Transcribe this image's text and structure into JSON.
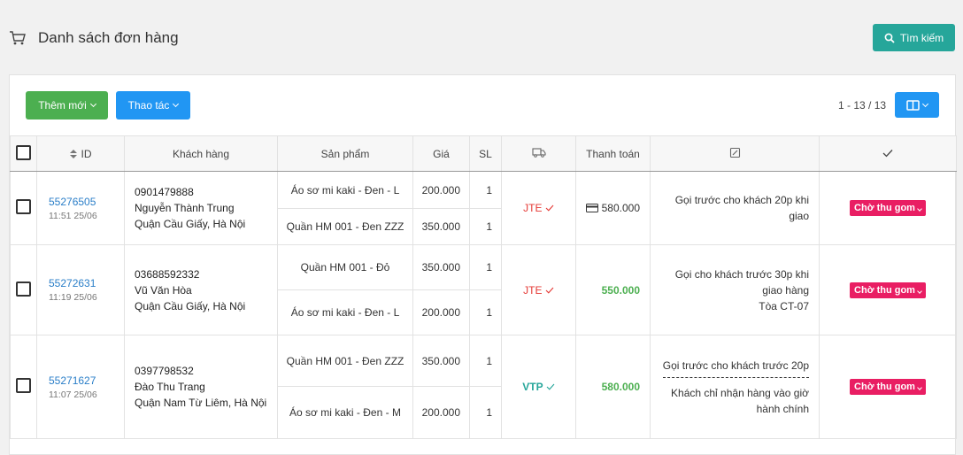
{
  "header": {
    "title": "Danh sách đơn hàng",
    "search_label": "Tìm kiếm"
  },
  "toolbar": {
    "add_label": "Thêm mới",
    "actions_label": "Thao tác",
    "pager": "1 - 13 / 13"
  },
  "columns": {
    "id": "ID",
    "customer": "Khách hàng",
    "product": "Sản phẩm",
    "price": "Giá",
    "qty": "SL",
    "payment": "Thanh toán"
  },
  "orders": [
    {
      "id": "55276505",
      "time": "11:51 25/06",
      "phone": "0901479888",
      "name": "Nguyễn Thành Trung",
      "address": "Quận Cầu Giấy, Hà Nội",
      "items": [
        {
          "product": "Áo sơ mi kaki - Đen - L",
          "price": "200.000",
          "qty": "1"
        },
        {
          "product": "Quần HM 001 - Đen ZZZ",
          "price": "350.000",
          "qty": "1"
        }
      ],
      "carrier": "JTE",
      "carrier_color": "#e53935",
      "payment": "580.000",
      "payment_icon": "credit-card-icon",
      "note_1": "Gọi trước cho khách 20p khi",
      "note_2": "giao",
      "status": "Chờ thu gom"
    },
    {
      "id": "55272631",
      "time": "11:19 25/06",
      "phone": "03688592332",
      "name": "Vũ Văn Hòa",
      "address": "Quận Cầu Giấy, Hà Nội",
      "items": [
        {
          "product": "Quần HM 001 - Đỏ",
          "price": "350.000",
          "qty": "1"
        },
        {
          "product": "Áo sơ mi kaki - Đen - L",
          "price": "200.000",
          "qty": "1"
        }
      ],
      "carrier": "JTE",
      "carrier_color": "#e53935",
      "payment": "550.000",
      "note_1": "Gọi cho khách trước 30p khi",
      "note_2": "giao hàng",
      "note_3": "Tòa CT-07",
      "status": "Chờ thu gom"
    },
    {
      "id": "55271627",
      "time": "11:07 25/06",
      "phone": "0397798532",
      "name": "Đào Thu Trang",
      "address": "Quận Nam Từ Liêm, Hà Nội",
      "items": [
        {
          "product": "Quần HM 001 - Đen ZZZ",
          "price": "350.000",
          "qty": "1"
        },
        {
          "product": "Áo sơ mi kaki - Đen - M",
          "price": "200.000",
          "qty": "1"
        }
      ],
      "carrier": "VTP",
      "carrier_color": "#26a69a",
      "payment": "580.000",
      "note_1": "Gọi trước cho khách trước 20p",
      "note_2": "Khách chỉ nhận hàng vào giờ",
      "note_3": "hành chính",
      "status": "Chờ thu gom"
    }
  ],
  "colors": {
    "accent_teal": "#26a69a",
    "green": "#4caf50",
    "blue": "#2196f3",
    "pink": "#e91e63",
    "link": "#2a7ec8"
  }
}
